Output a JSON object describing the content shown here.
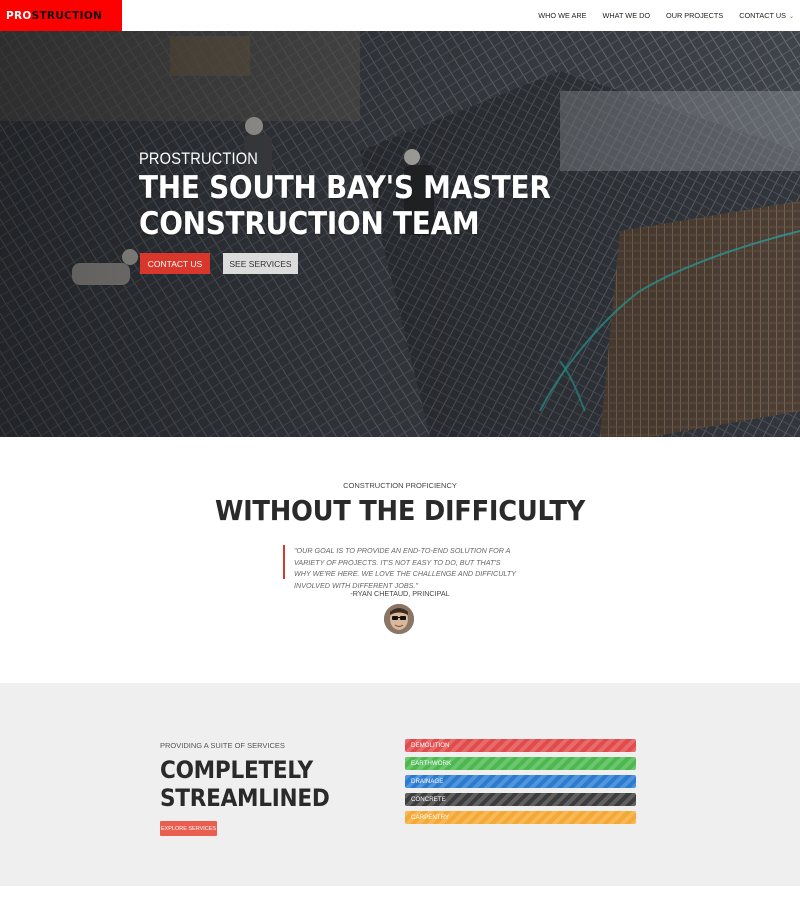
{
  "header": {
    "logo_pro": "PRO",
    "logo_struction": "STRUCTION",
    "nav": [
      "WHO WE ARE",
      "WHAT WE DO",
      "OUR PROJECTS",
      "CONTACT US"
    ]
  },
  "hero": {
    "eyebrow": "PROSTRUCTION",
    "title_line1": "THE SOUTH BAY'S MASTER",
    "title_line2": "CONSTRUCTION TEAM",
    "contact_label": "CONTACT US",
    "services_label": "SEE SERVICES"
  },
  "proficiency": {
    "eyebrow": "CONSTRUCTION PROFICIENCY",
    "title": "WITHOUT THE DIFFICULTY",
    "quote": "\"OUR GOAL IS TO PROVIDE AN END-TO-END SOLUTION FOR A VARIETY OF PROJECTS. IT'S NOT EASY TO DO, BUT THAT'S WHY WE'RE HERE. WE LOVE THE CHALLENGE AND DIFFICULTY INVOLVED WITH DIFFERENT JOBS.\"",
    "attribution": "-RYAN CHETAUD, PRINCIPAL"
  },
  "services": {
    "eyebrow": "PROVIDING A SUITE OF SERVICES",
    "title_line1": "COMPLETELY",
    "title_line2": "STREAMLINED",
    "button_label": "EXPLORE SERVICES",
    "items": [
      {
        "label": "DEMOLITION",
        "color": "#e24b4b"
      },
      {
        "label": "EARTHWORK",
        "color": "#4cb84f"
      },
      {
        "label": "DRAINAGE",
        "color": "#2b7cd1"
      },
      {
        "label": "CONCRETE",
        "color": "#3d3d3d"
      },
      {
        "label": "CARPENTRY",
        "color": "#f5a833"
      }
    ]
  },
  "colors": {
    "brand_red": "#ff0000",
    "accent_red": "#d9372b",
    "section_gray": "#efeff0"
  }
}
